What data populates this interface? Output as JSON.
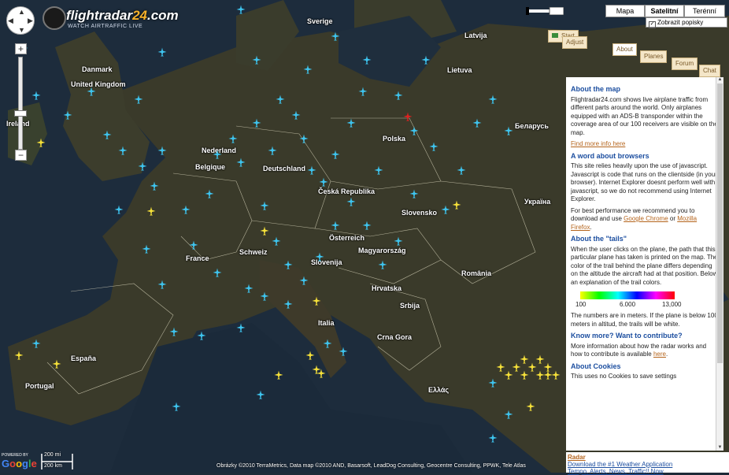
{
  "logo": {
    "name_part": "flightradar",
    "num_part": "24",
    "tld": ".com",
    "tagline": "WATCH AIRTRAFFIC LIVE"
  },
  "map_type": {
    "map": "Mapa",
    "satellite": "Satelitní",
    "terrain": "Terénní",
    "labels": "Zobrazit popisky",
    "active": "Satelitní"
  },
  "zoom": {
    "plus": "+",
    "minus": "−"
  },
  "tabs": {
    "start": "Start",
    "adjust": "Adjust",
    "about": "About",
    "planes": "Planes",
    "forum": "Forum",
    "chat": "Chat"
  },
  "panel": {
    "about_title": "About the map",
    "about_text": "Flightradar24.com shows live airplane traffic from different parts around the world. Only airplanes equipped with an ADS-B transponder within the coverage area of our 100 receivers are visible on the map.",
    "find_more": "Find more info here",
    "browsers_title": "A word about browsers",
    "browsers_text": "This site relies heavily upon the use of javascript. Javascript is code that runs on the clientside (in your browser). Internet Explorer doesnt perform well with javascript, so we do not recommend using Internet Explorer.",
    "best_perf_pre": "For best performance we recommend you to download and use ",
    "chrome": "Google Chrome",
    "or": " or ",
    "firefox": "Mozilla Firefox",
    "tails_title": "About the \"tails\"",
    "tails_text": "When the user clicks on the plane, the path that this particular plane has taken is printed on the map. The color of the trail behind the plane differs depending on the altitude the aircraft had at that position. Below an explanation of the trail colors.",
    "legend": [
      "100",
      "6.000",
      "13,000"
    ],
    "meters_text": "The numbers are in meters. If the plane is below 100 meters in altitud, the trails will be white.",
    "contribute_title": "Know more? Want to contribute?",
    "contribute_text": "More information about how the radar works and how to contribute is available ",
    "here": "here",
    "cookies_title": "About Cookies",
    "cookies_text": "This uses no Cookies to save settings"
  },
  "bottom_panel": {
    "radar": "Radar",
    "link": "Download the #1 Weather Application",
    "link2": "Tempo, Alerts, News, Traffic!! Now"
  },
  "footer": {
    "credits": "Obrázky ©2010 TerraMetrics, Data map ©2010 AND, Basarsoft, LeadDog Consulting, Geocentre Consulting, PPWK, Tele Atlas"
  },
  "scale": {
    "mi": "200 mi",
    "km": "200 km"
  },
  "google": {
    "powered": "POWERED BY",
    "word": "Google"
  },
  "countries": [
    {
      "name": "United Kingdom"
    },
    {
      "name": "Ireland"
    },
    {
      "name": "France"
    },
    {
      "name": "Deutschland"
    },
    {
      "name": "Polska"
    },
    {
      "name": "Italia"
    },
    {
      "name": "España"
    },
    {
      "name": "Portugal"
    },
    {
      "name": "Česká Republika"
    },
    {
      "name": "Österreich"
    },
    {
      "name": "Magyarország"
    },
    {
      "name": "România"
    },
    {
      "name": "Беларусь"
    },
    {
      "name": "Україна"
    },
    {
      "name": "Danmark"
    },
    {
      "name": "Latvija"
    },
    {
      "name": "Lietuva"
    },
    {
      "name": "Nederland"
    },
    {
      "name": "Belgique"
    },
    {
      "name": "Schweiz"
    },
    {
      "name": "Slovenija"
    },
    {
      "name": "Hrvatska"
    },
    {
      "name": "Srbija"
    },
    {
      "name": "Ελλάς"
    },
    {
      "name": "Crna Gora"
    },
    {
      "name": "Sverige"
    },
    {
      "name": "Slovensko"
    }
  ]
}
